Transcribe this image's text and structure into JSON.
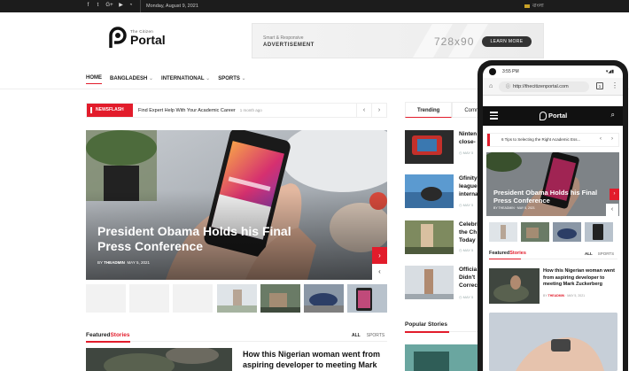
{
  "topbar": {
    "social_icons": [
      "facebook-icon",
      "twitter-icon",
      "google-plus-icon",
      "youtube-icon",
      "rss-icon"
    ],
    "date": "Monday, August 9, 2021",
    "language": "বাংলা"
  },
  "logo": {
    "tagline": "The Citizen",
    "name": "Portal"
  },
  "ad": {
    "line1": "Smart & Responsive",
    "line2": "ADVERTISEMENT",
    "size": "728x90",
    "button": "LEARN MORE"
  },
  "nav": {
    "items": [
      {
        "label": "HOME",
        "dropdown": false
      },
      {
        "label": "BANGLADESH",
        "dropdown": true
      },
      {
        "label": "INTERNATIONAL",
        "dropdown": true
      },
      {
        "label": "SPORTS",
        "dropdown": true
      }
    ]
  },
  "newsflash": {
    "badge": "NEWSFLASH",
    "title": "Find Expert Help With Your Academic Career",
    "time_ago": "1 month ago"
  },
  "hero": {
    "title": "President Obama Holds his Final Press Conference",
    "author": "THEADMIN",
    "date": "MAY 5, 2021"
  },
  "featured": {
    "title_a": "Featured",
    "title_b": "Stories",
    "tabs": [
      "ALL",
      "SPORTS"
    ],
    "article_title": "How this Nigerian woman went from aspiring developer to meeting Mark"
  },
  "sidebar": {
    "tabs": [
      "Trending",
      "Comm"
    ],
    "items": [
      {
        "title": "Ninten close-",
        "meta": "MAY 5"
      },
      {
        "title": "Gfinity league internat",
        "meta": "MAY 5"
      },
      {
        "title": "Celebri the Ch Today",
        "meta": "MAY 5"
      },
      {
        "title": "Officia Didn't Correc",
        "meta": "MAY 5"
      }
    ],
    "popular_title": "Popular Stories"
  },
  "phone": {
    "time": "3:55 PM",
    "url": "http://thecitizenportal.com",
    "tab_count": "1",
    "logo_name": "Portal",
    "newsflash": "6 Tips to Selecting the Right Academic Ess...",
    "hero_title": "President Obama Holds his Final Press Conference",
    "hero_meta": "BY THEADMIN · MAY 5, 2021",
    "featured_a": "Featured",
    "featured_b": "Stories",
    "featured_tabs": [
      "ALL",
      "SPORTS"
    ],
    "article_title": "How this Nigerian woman went from aspiring developer to meeting Mark Zuckerberg",
    "article_by": "BY",
    "article_author": "THEADMIN",
    "article_date": "MAY 5, 2021"
  },
  "colors": {
    "accent": "#e21c2b",
    "topbar": "#1c1c1c"
  }
}
